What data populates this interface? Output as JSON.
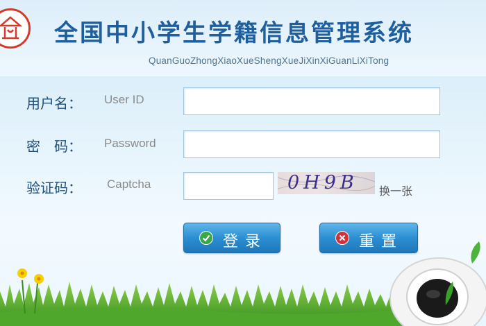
{
  "header": {
    "title": "全国中小学生学籍信息管理系统",
    "pinyin": "QuanGuoZhongXiaoXueShengXueJiXinXiGuanLiXiTong"
  },
  "form": {
    "username_label": "用户名：",
    "username_hint": "User ID",
    "password_label": "密　码：",
    "password_hint": "Password",
    "captcha_label": "验证码：",
    "captcha_hint": "Captcha",
    "captcha_image_text": "0H9B",
    "refresh_label": "换一张"
  },
  "buttons": {
    "login_label": "登录",
    "reset_label": "重置"
  },
  "colors": {
    "accent": "#1f5f9e",
    "button": "#2a8fd1",
    "login_icon": "#3aa84a",
    "reset_icon": "#d2303b"
  },
  "icons": {
    "logo": "school-emblem-icon",
    "login": "check-circle-icon",
    "reset": "close-circle-icon"
  }
}
